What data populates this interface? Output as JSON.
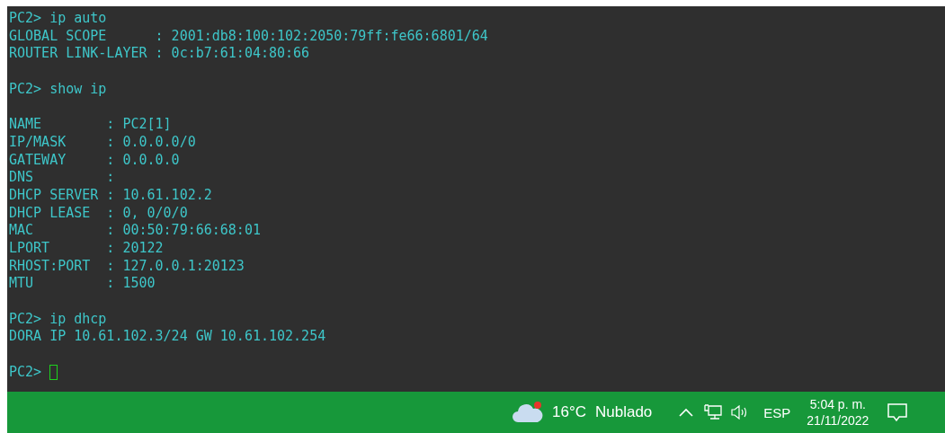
{
  "terminal": {
    "lines": [
      {
        "kind": "prompt",
        "prompt": "PC2>",
        "command": "ip auto"
      },
      {
        "kind": "output",
        "text": "GLOBAL SCOPE      : 2001:db8:100:102:2050:79ff:fe66:6801/64"
      },
      {
        "kind": "output",
        "text": "ROUTER LINK-LAYER : 0c:b7:61:04:80:66"
      },
      {
        "kind": "blank"
      },
      {
        "kind": "prompt",
        "prompt": "PC2>",
        "command": "show ip"
      },
      {
        "kind": "blank"
      },
      {
        "kind": "output",
        "text": "NAME        : PC2[1]"
      },
      {
        "kind": "output",
        "text": "IP/MASK     : 0.0.0.0/0"
      },
      {
        "kind": "output",
        "text": "GATEWAY     : 0.0.0.0"
      },
      {
        "kind": "output",
        "text": "DNS         :"
      },
      {
        "kind": "output",
        "text": "DHCP SERVER : 10.61.102.2"
      },
      {
        "kind": "output",
        "text": "DHCP LEASE  : 0, 0/0/0"
      },
      {
        "kind": "output",
        "text": "MAC         : 00:50:79:66:68:01"
      },
      {
        "kind": "output",
        "text": "LPORT       : 20122"
      },
      {
        "kind": "output",
        "text": "RHOST:PORT  : 127.0.0.1:20123"
      },
      {
        "kind": "output",
        "text": "MTU         : 1500"
      },
      {
        "kind": "blank"
      },
      {
        "kind": "prompt",
        "prompt": "PC2>",
        "command": "ip dhcp"
      },
      {
        "kind": "output",
        "text": "DORA IP 10.61.102.3/24 GW 10.61.102.254"
      },
      {
        "kind": "blank"
      },
      {
        "kind": "cursor",
        "prompt": "PC2>"
      }
    ]
  },
  "taskbar": {
    "weather": {
      "temperature": "16°C",
      "condition": "Nublado",
      "alert": true
    },
    "language": "ESP",
    "time": "5:04 p. m.",
    "date": "21/11/2022"
  }
}
